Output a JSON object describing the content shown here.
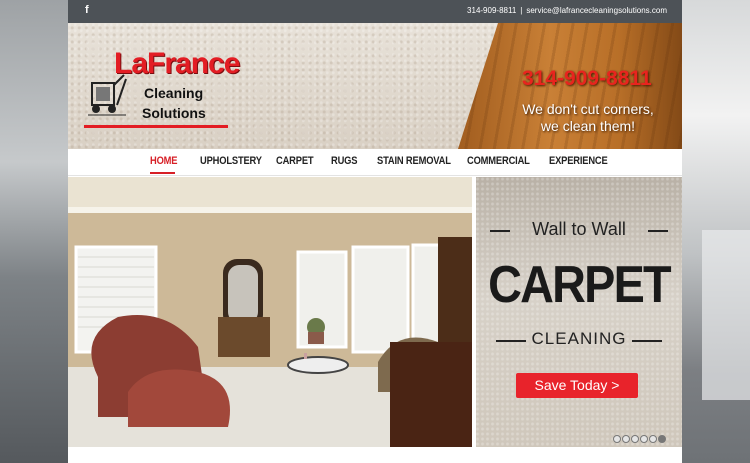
{
  "topbar": {
    "social_icon": "facebook-icon",
    "social_glyph": "f",
    "phone": "314-909-8811",
    "separator": "|",
    "email": "service@lafrancecleaningsolutions.com"
  },
  "header": {
    "logo": {
      "brand": "LaFrance",
      "line1": "Cleaning",
      "line2": "Solutions"
    },
    "phone": "314-909-8811",
    "tagline_line1": "We don't cut corners,",
    "tagline_line2": "we clean them!"
  },
  "nav": {
    "items": [
      {
        "label": "HOME",
        "active": true
      },
      {
        "label": "UPHOLSTERY"
      },
      {
        "label": "CARPET"
      },
      {
        "label": "RUGS"
      },
      {
        "label": "STAIN REMOVAL"
      },
      {
        "label": "COMMERCIAL"
      },
      {
        "label": "EXPERIENCE"
      }
    ]
  },
  "promo": {
    "title": "Wall to Wall",
    "headline": "CARPET",
    "subhead": "CLEANING",
    "button": "Save Today >"
  },
  "slider": {
    "dot_count": 6,
    "active_index": 5
  },
  "colors": {
    "accent_red": "#e31d24",
    "topbar": "#4d5257"
  }
}
